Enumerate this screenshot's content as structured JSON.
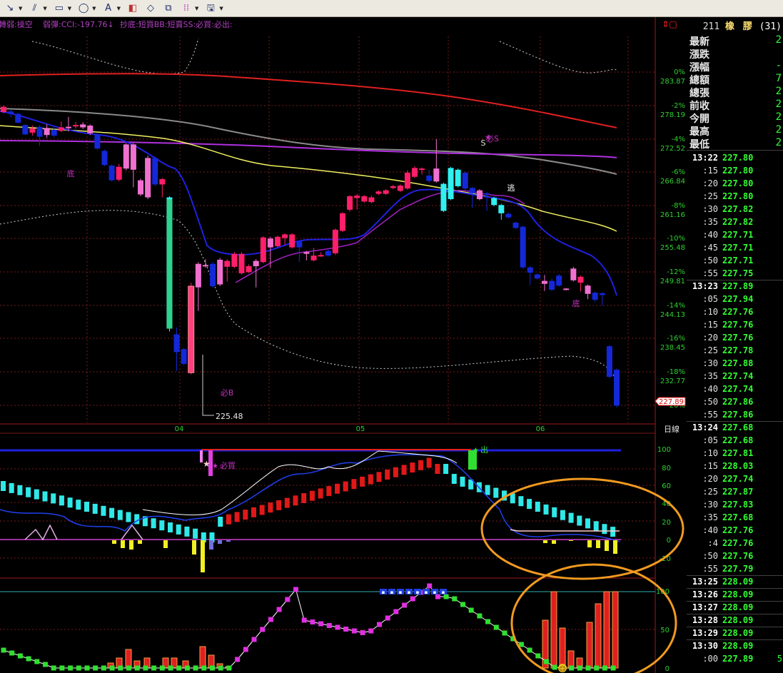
{
  "toolbar": {
    "tools": [
      "line-tool-icon",
      "parallel-lines-icon",
      "rectangle-icon",
      "ellipse-icon",
      "text-annotate-icon",
      "ruler-icon",
      "eraser-icon",
      "copy-chart-icon",
      "color-palette-icon",
      "save-icon"
    ]
  },
  "legend": {
    "text_1": "轉弱:操空",
    "text_2": "弱彈:CCI:-197.76↓",
    "text_3": "抄底:短買BB:短賣SS:必買:必出:"
  },
  "colors": {
    "background": "#000000",
    "up_candle": "#ff1f6a",
    "up_candle_light": "#f070d0",
    "down_candle": "#1428d8",
    "down_candle_light": "#30f0f0",
    "ma_red": "#e02020",
    "ma_gray": "#8a8a8a",
    "ma_purple": "#b030e0",
    "ma_yellow": "#f0f060",
    "ma_blue": "#2020e0",
    "grid": "#7a1a1a",
    "axis_text": "#30d030",
    "annotation_orange": "#f09a20"
  },
  "chart_data": [
    {
      "type": "candlestick",
      "x_labels": [
        "04",
        "05",
        "06"
      ],
      "y_ticks_price": [
        "283.87",
        "278.19",
        "272.52",
        "266.84",
        "261.16",
        "255.48",
        "249.81",
        "244.13",
        "238.45",
        "232.77"
      ],
      "y_ticks_pct": [
        "0%",
        "-2%",
        "-4%",
        "-6%",
        "-8%",
        "-10%",
        "-12%",
        "-14%",
        "-16%",
        "-18%",
        "-20%"
      ],
      "last_price_label": "227.89",
      "low_label": "225.48",
      "ylim": [
        225,
        287
      ],
      "candles": [
        [
          278.7,
          277.8,
          278.9,
          277.6,
          "u"
        ],
        [
          277.9,
          277.5,
          278.2,
          276.9,
          "d"
        ],
        [
          277.5,
          276.0,
          277.7,
          275.9,
          "d"
        ],
        [
          275.6,
          274.0,
          275.7,
          273.9,
          "d"
        ],
        [
          274.3,
          275.0,
          275.5,
          273.8,
          "u"
        ],
        [
          275.3,
          273.6,
          275.6,
          272.0,
          "d"
        ],
        [
          273.9,
          275.1,
          275.7,
          273.4,
          "l"
        ],
        [
          274.8,
          273.8,
          275.3,
          273.5,
          "d"
        ],
        [
          274.6,
          275.2,
          276.2,
          274.4,
          "u"
        ],
        [
          275.2,
          275.3,
          277.0,
          274.5,
          "l"
        ],
        [
          275.4,
          275.6,
          276.1,
          275.0,
          "u"
        ],
        [
          275.7,
          275.2,
          276.1,
          274.9,
          "l"
        ],
        [
          275.5,
          274.2,
          275.7,
          273.9,
          "l"
        ],
        [
          274.0,
          271.6,
          274.2,
          271.4,
          "d"
        ],
        [
          271.2,
          268.8,
          271.4,
          268.6,
          "d"
        ],
        [
          268.7,
          266.2,
          268.9,
          266.0,
          "d"
        ],
        [
          266.3,
          268.5,
          269.0,
          266.0,
          "u"
        ],
        [
          268.2,
          272.3,
          272.5,
          267.9,
          "l"
        ],
        [
          272.3,
          268.0,
          272.5,
          265.0,
          "l"
        ],
        [
          266.2,
          263.8,
          266.5,
          263.5,
          "l"
        ],
        [
          263.3,
          270.0,
          270.4,
          263.0,
          "l"
        ],
        [
          270.0,
          265.5,
          270.3,
          265.2,
          "d"
        ],
        [
          266.4,
          265.5,
          266.6,
          263.3,
          "u"
        ],
        [
          263.3,
          241.0,
          263.5,
          240.5,
          "c"
        ],
        [
          240.0,
          237.0,
          241.2,
          233.8,
          "d"
        ],
        [
          237.5,
          235.0,
          237.7,
          234.7,
          "d"
        ],
        [
          233.5,
          248.2,
          248.8,
          233.2,
          "u"
        ],
        [
          248.0,
          252.0,
          252.3,
          244.0,
          "l"
        ],
        [
          251.8,
          251.7,
          252.8,
          251.4,
          "l"
        ],
        [
          252.0,
          248.2,
          252.3,
          247.9,
          "d"
        ],
        [
          248.5,
          252.7,
          253.0,
          248.2,
          "l"
        ],
        [
          252.5,
          251.5,
          252.8,
          249.0,
          "u"
        ],
        [
          251.5,
          253.7,
          254.0,
          251.3,
          "u"
        ],
        [
          253.7,
          250.4,
          254.0,
          250.2,
          "u"
        ],
        [
          250.6,
          251.6,
          251.9,
          250.4,
          "u"
        ],
        [
          251.6,
          252.5,
          252.8,
          248.0,
          "l"
        ],
        [
          252.3,
          256.5,
          256.7,
          252.1,
          "u"
        ],
        [
          256.3,
          254.8,
          256.6,
          251.3,
          "l"
        ],
        [
          255.0,
          256.6,
          256.8,
          254.8,
          "u"
        ],
        [
          256.4,
          257.0,
          257.2,
          255.2,
          "u"
        ],
        [
          257.0,
          254.8,
          257.2,
          254.6,
          "u"
        ],
        [
          254.8,
          255.8,
          256.0,
          252.3,
          "d"
        ],
        [
          254.0,
          253.7,
          254.2,
          252.6,
          "l"
        ],
        [
          253.4,
          252.6,
          254.7,
          252.4,
          "u"
        ],
        [
          253.4,
          253.5,
          254.0,
          253.2,
          "u"
        ],
        [
          253.4,
          254.2,
          254.5,
          253.2,
          "d"
        ],
        [
          253.8,
          257.8,
          258.0,
          253.5,
          "u"
        ],
        [
          260.6,
          257.6,
          260.8,
          257.4,
          "u"
        ],
        [
          263.5,
          261.2,
          263.7,
          260.9,
          "u"
        ],
        [
          263.6,
          263.2,
          263.9,
          261.2,
          "u"
        ],
        [
          263.5,
          262.6,
          263.7,
          262.4,
          "u"
        ],
        [
          262.5,
          263.3,
          263.6,
          262.3,
          "u"
        ],
        [
          264.3,
          263.9,
          264.5,
          263.7,
          "u"
        ],
        [
          264.5,
          263.9,
          264.7,
          263.7,
          "u"
        ],
        [
          265.2,
          264.9,
          265.4,
          264.7,
          "u"
        ],
        [
          265.3,
          264.4,
          265.5,
          264.2,
          "u"
        ],
        [
          264.8,
          267.5,
          267.9,
          264.6,
          "u"
        ],
        [
          266.8,
          268.3,
          268.6,
          266.6,
          "u"
        ],
        [
          268.2,
          268.0,
          268.4,
          267.2,
          "u"
        ],
        [
          267.0,
          266.1,
          268.0,
          265.8,
          "d"
        ],
        [
          266.0,
          268.2,
          273.2,
          265.8,
          "l"
        ],
        [
          265.6,
          261.0,
          265.8,
          260.8,
          "c"
        ],
        [
          263.0,
          268.3,
          268.5,
          262.8,
          "c"
        ],
        [
          268.0,
          265.2,
          268.2,
          265.0,
          "c"
        ],
        [
          267.5,
          264.8,
          267.7,
          264.6,
          "d"
        ],
        [
          264.9,
          264.0,
          265.1,
          261.5,
          "d"
        ],
        [
          264.5,
          263.0,
          264.7,
          262.8,
          "l"
        ],
        [
          264.0,
          263.9,
          264.2,
          261.0,
          "d"
        ],
        [
          263.2,
          262.0,
          263.4,
          261.8,
          "c"
        ],
        [
          262.0,
          260.6,
          262.2,
          259.5,
          "c"
        ],
        [
          260.5,
          259.9,
          260.7,
          259.7,
          "d"
        ],
        [
          259.0,
          258.1,
          259.2,
          257.9,
          "d"
        ],
        [
          258.3,
          251.4,
          258.5,
          251.2,
          "d"
        ],
        [
          251.4,
          250.5,
          251.6,
          248.4,
          "d"
        ],
        [
          250.2,
          249.5,
          250.4,
          249.3,
          "d"
        ],
        [
          248.6,
          249.1,
          250.1,
          247.4,
          "l"
        ],
        [
          249.1,
          247.6,
          249.5,
          247.4,
          "d"
        ],
        [
          248.3,
          250.0,
          250.3,
          248.1,
          "d"
        ],
        [
          247.6,
          247.8,
          247.9,
          247.5,
          "l"
        ],
        [
          249.2,
          251.2,
          251.5,
          249.0,
          "l"
        ],
        [
          249.8,
          248.8,
          250.0,
          247.3,
          "u"
        ],
        [
          248.3,
          246.9,
          248.5,
          246.0,
          "l"
        ],
        [
          247.1,
          245.9,
          247.3,
          245.5,
          "d"
        ],
        [
          247.0,
          246.7,
          247.2,
          244.9,
          "d"
        ],
        [
          238.0,
          232.8,
          238.2,
          232.5,
          "d"
        ],
        [
          234.0,
          227.9,
          234.2,
          227.6,
          "d"
        ]
      ],
      "annotations": [
        "底",
        "底",
        "必B",
        "必S",
        "S",
        "逃"
      ]
    },
    {
      "type": "line+histogram",
      "y_ticks": [
        "100",
        "80",
        "60",
        "40",
        "20",
        "0",
        "-20"
      ],
      "label": "日線",
      "signal_labels": [
        "必買",
        "出"
      ]
    },
    {
      "type": "line+bar",
      "y_ticks": [
        "100",
        "50",
        "0"
      ]
    }
  ],
  "quote": {
    "code": "211",
    "name": "橡 膠",
    "count": "(31)",
    "rows": [
      {
        "label": "最新",
        "value": "2"
      },
      {
        "label": "漲跌",
        "value": ""
      },
      {
        "label": "漲幅",
        "value": "-"
      },
      {
        "label": "總額",
        "value": "7"
      },
      {
        "label": "總張",
        "value": "2"
      },
      {
        "label": "前收",
        "value": "2"
      },
      {
        "label": "今開",
        "value": "2"
      },
      {
        "label": "最高",
        "value": "2"
      },
      {
        "label": "最低",
        "value": "2"
      }
    ],
    "ticks": [
      {
        "t": "13:22",
        "p": "227.80",
        "full": true
      },
      {
        "t": ":15",
        "p": "227.80"
      },
      {
        "t": ":20",
        "p": "227.80"
      },
      {
        "t": ":25",
        "p": "227.80"
      },
      {
        "t": ":30",
        "p": "227.82"
      },
      {
        "t": ":35",
        "p": "227.82"
      },
      {
        "t": ":40",
        "p": "227.71"
      },
      {
        "t": ":45",
        "p": "227.71"
      },
      {
        "t": ":50",
        "p": "227.71"
      },
      {
        "t": ":55",
        "p": "227.75"
      },
      {
        "t": "13:23",
        "p": "227.89",
        "full": true
      },
      {
        "t": ":05",
        "p": "227.94"
      },
      {
        "t": ":10",
        "p": "227.76"
      },
      {
        "t": ":15",
        "p": "227.76"
      },
      {
        "t": ":20",
        "p": "227.76"
      },
      {
        "t": ":25",
        "p": "227.78"
      },
      {
        "t": ":30",
        "p": "227.88"
      },
      {
        "t": ":35",
        "p": "227.74"
      },
      {
        "t": ":40",
        "p": "227.74"
      },
      {
        "t": ":50",
        "p": "227.86"
      },
      {
        "t": ":55",
        "p": "227.86"
      },
      {
        "t": "13:24",
        "p": "227.68",
        "full": true
      },
      {
        "t": ":05",
        "p": "227.68"
      },
      {
        "t": ":10",
        "p": "227.81"
      },
      {
        "t": ":15",
        "p": "228.03"
      },
      {
        "t": ":20",
        "p": "227.74"
      },
      {
        "t": ":25",
        "p": "227.87"
      },
      {
        "t": ":30",
        "p": "227.83"
      },
      {
        "t": ":35",
        "p": "227.68"
      },
      {
        "t": ":40",
        "p": "227.76"
      },
      {
        "t": ":4",
        "p": "227.76"
      },
      {
        "t": ":50",
        "p": "227.76"
      },
      {
        "t": ":55",
        "p": "227.79"
      },
      {
        "t": "13:25",
        "p": "228.09",
        "full": true
      },
      {
        "t": "13:26",
        "p": "228.09",
        "full": true
      },
      {
        "t": "13:27",
        "p": "228.09",
        "full": true
      },
      {
        "t": "13:28",
        "p": "228.09",
        "full": true
      },
      {
        "t": "13:29",
        "p": "228.09",
        "full": true
      },
      {
        "t": "13:30",
        "p": "228.09",
        "full": true
      },
      {
        "t": ":00",
        "p": "227.89",
        "v": "5"
      }
    ]
  }
}
